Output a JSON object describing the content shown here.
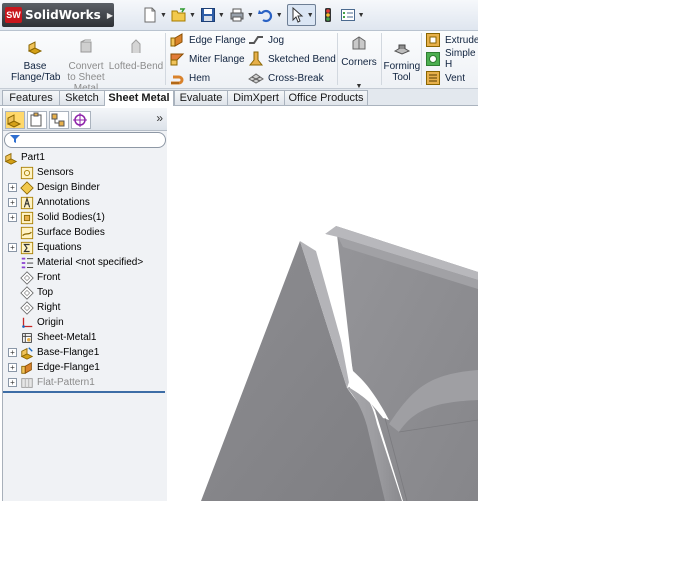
{
  "app": {
    "name": "SolidWorks",
    "logo_letters": "SW"
  },
  "ribbon": {
    "base_flange": "Base Flange/Tab",
    "convert": "Convert to Sheet Metal",
    "lofted_bend": "Lofted-Bend",
    "edge_flange": "Edge Flange",
    "miter_flange": "Miter Flange",
    "hem": "Hem",
    "jog": "Jog",
    "sketched_bend": "Sketched Bend",
    "cross_break": "Cross-Break",
    "corners": "Corners",
    "forming_tool": "Forming Tool",
    "extruded": "Extruded",
    "simple_hole": "Simple H",
    "vent": "Vent"
  },
  "tabs": [
    "Features",
    "Sketch",
    "Sheet Metal",
    "Evaluate",
    "DimXpert",
    "Office Products"
  ],
  "active_tab": "Sheet Metal",
  "panel": {
    "chevron": "»"
  },
  "tree": {
    "root": "Part1",
    "items": [
      "Sensors",
      "Design Binder",
      "Annotations",
      "Solid Bodies(1)",
      "Surface Bodies",
      "Equations",
      "Material <not specified>",
      "Front",
      "Top",
      "Right",
      "Origin",
      "Sheet-Metal1",
      "Base-Flange1",
      "Edge-Flange1",
      "Flat-Pattern1"
    ]
  },
  "colors": {
    "accent": "#3d6da6",
    "logo_red": "#c8161d",
    "model_gray": "#8b8b8f"
  }
}
